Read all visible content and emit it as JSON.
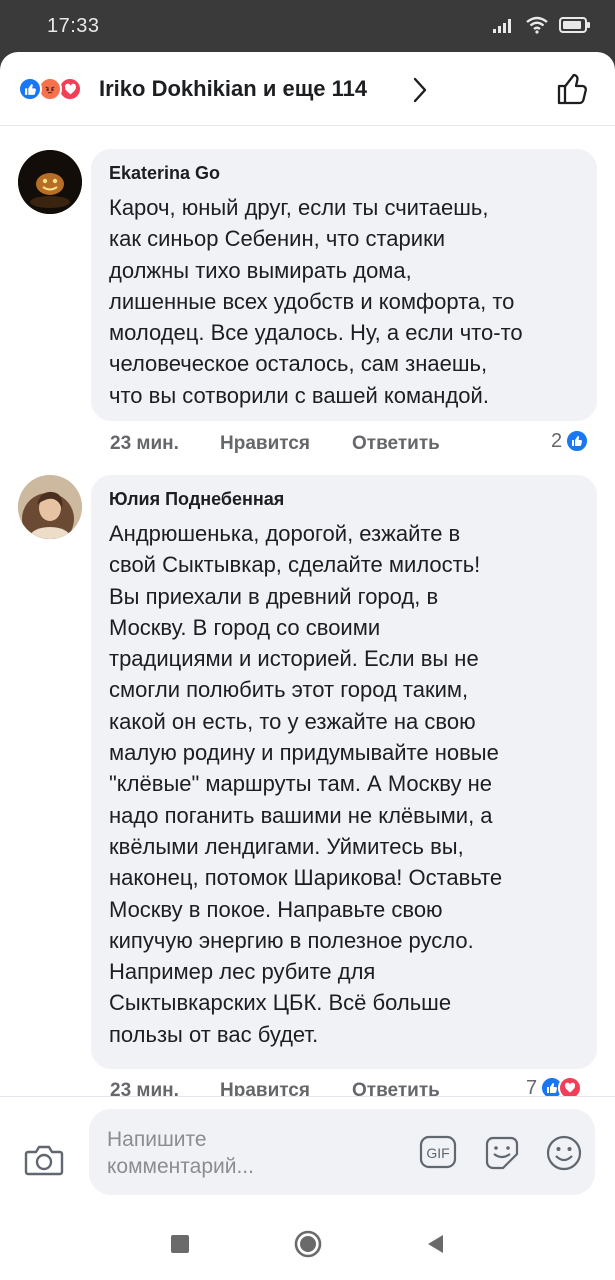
{
  "status_bar": {
    "time": "17:33"
  },
  "reactions_header": {
    "names": "Iriko Dokhikian и еще 114",
    "icons": [
      "like-icon",
      "angry-icon",
      "love-icon"
    ],
    "colors": {
      "like": "#1877f2",
      "angry": "#f7714c",
      "love": "#f33e58"
    }
  },
  "comments": [
    {
      "author": "Ekaterina Go",
      "text": "Кароч, юный друг, если ты считаешь,\nкак синьор Себенин, что старики\nдолжны тихо вымирать дома,\nлишенные всех удобств и комфорта, то\nмолодец. Все удалось. Ну, а если что-то\nчеловеческое осталось, сам знаешь,\nчто вы сотворили с вашей командой.",
      "time": "23 мин.",
      "like_label": "Нравится",
      "reply_label": "Ответить",
      "reaction_count": "2"
    },
    {
      "author": "Юлия Поднебенная",
      "text": "Андрюшенька, дорогой, езжайте в\nсвой Сыктывкар, сделайте милость!\nВы приехали в древний город, в\nМоскву. В город со своими\nтрадициями и историей. Если вы не\nсмогли полюбить этот город таким,\nкакой он есть, то у езжайте на свою\nмалую родину и придумывайте новые\n\"клёвые\" маршруты там. А Москву не\nнадо поганить вашими не клёвыми, а\nквёлыми лендигами. Уймитесь вы,\nнаконец, потомок Шарикова! Оставьте\nМоскву в покое. Направьте свою\nкипучую энергию в полезное русло.\nНапример лес рубите для\nСыктывкарских ЦБК. Всё больше\nпользы от вас будет.",
      "time": "23 мин.",
      "like_label": "Нравится",
      "reply_label": "Ответить",
      "reaction_count": "7"
    }
  ],
  "composer": {
    "placeholder": "Напишите\nкомментарий..."
  }
}
